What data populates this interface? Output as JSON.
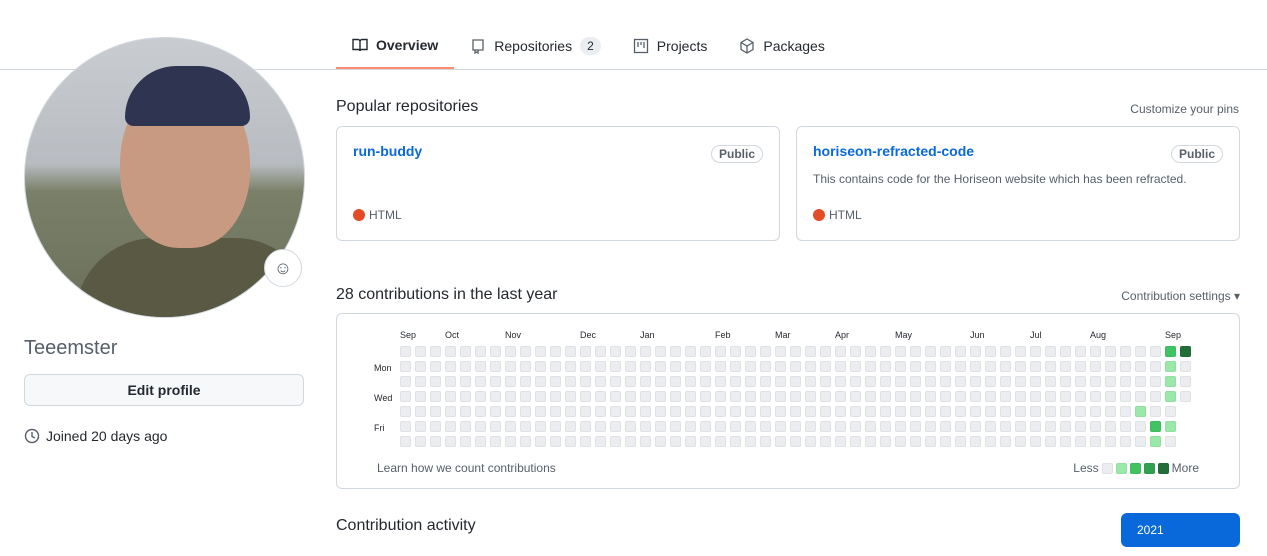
{
  "tabs": [
    {
      "label": "Overview",
      "icon": "book-icon"
    },
    {
      "label": "Repositories",
      "count": "2",
      "icon": "repo-icon"
    },
    {
      "label": "Projects",
      "icon": "project-icon"
    },
    {
      "label": "Packages",
      "icon": "package-icon"
    }
  ],
  "profile": {
    "username": "Teeemster",
    "edit_label": "Edit profile",
    "joined": "Joined 20 days ago"
  },
  "popular": {
    "title": "Popular repositories",
    "customize": "Customize your pins",
    "repos": [
      {
        "name": "run-buddy",
        "visibility": "Public",
        "description": "",
        "language": "HTML",
        "lang_color": "#e34c26"
      },
      {
        "name": "horiseon-refracted-code",
        "visibility": "Public",
        "description": "This contains code for the Horiseon website which has been refracted.",
        "language": "HTML",
        "lang_color": "#e34c26"
      }
    ]
  },
  "contributions": {
    "title": "28 contributions in the last year",
    "settings": "Contribution settings ▾",
    "learn": "Learn how we count contributions",
    "less": "Less",
    "more": "More",
    "days": [
      "Mon",
      "Wed",
      "Fri"
    ],
    "months": [
      {
        "label": "Sep",
        "col": 0
      },
      {
        "label": "Oct",
        "col": 3
      },
      {
        "label": "Nov",
        "col": 7
      },
      {
        "label": "Dec",
        "col": 12
      },
      {
        "label": "Jan",
        "col": 16
      },
      {
        "label": "Feb",
        "col": 21
      },
      {
        "label": "Mar",
        "col": 25
      },
      {
        "label": "Apr",
        "col": 29
      },
      {
        "label": "May",
        "col": 33
      },
      {
        "label": "Jun",
        "col": 38
      },
      {
        "label": "Jul",
        "col": 42
      },
      {
        "label": "Aug",
        "col": 46
      },
      {
        "label": "Sep",
        "col": 51
      }
    ],
    "weeks": 53,
    "last_week_days": 4,
    "active": [
      {
        "col": 49,
        "row": 4,
        "level": 1
      },
      {
        "col": 50,
        "row": 5,
        "level": 2
      },
      {
        "col": 50,
        "row": 6,
        "level": 1
      },
      {
        "col": 51,
        "row": 0,
        "level": 2
      },
      {
        "col": 51,
        "row": 1,
        "level": 1
      },
      {
        "col": 51,
        "row": 2,
        "level": 1
      },
      {
        "col": 51,
        "row": 3,
        "level": 1
      },
      {
        "col": 51,
        "row": 5,
        "level": 1
      },
      {
        "col": 52,
        "row": 0,
        "level": 4
      }
    ],
    "colors": [
      "#ebedf0",
      "#9be9a8",
      "#40c463",
      "#30a14e",
      "#216e39"
    ]
  },
  "activity": {
    "title": "Contribution activity",
    "year": "2021"
  }
}
